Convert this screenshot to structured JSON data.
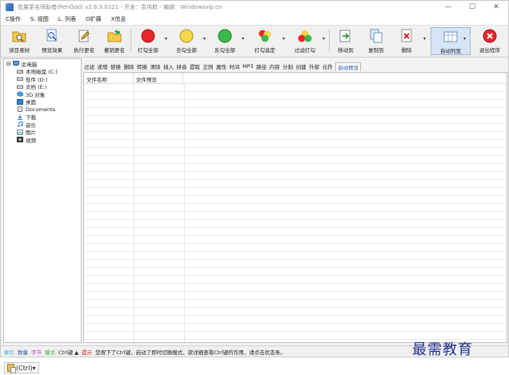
{
  "window": {
    "title": "批量更名师助者(RenGod) v2.6.3.0321 - 开发：袁伟航 - 编辑：Windowsvip.cn",
    "controls": [
      "—",
      "☐",
      "✕"
    ]
  },
  "menubar": {
    "items": [
      "C操作",
      "S. 视图",
      "L. 列表",
      "O扩展",
      "X信息"
    ]
  },
  "toolbar": {
    "buttons": [
      {
        "label": "读目录树",
        "icon": "folder-icon"
      },
      {
        "label": "预览效果",
        "icon": "magnifier-icon"
      },
      {
        "label": "执行更名",
        "icon": "pencil-icon"
      },
      {
        "label": "撤销更名",
        "icon": "undo-folder-icon"
      },
      {
        "label": "打勾全部",
        "icon": "red-circle-icon"
      },
      {
        "label": "去勾全部",
        "icon": "yellow-circle-icon"
      },
      {
        "label": "反勾全部",
        "icon": "green-circle-icon"
      },
      {
        "label": "打勾选定",
        "icon": "multi-color-circle-icon"
      },
      {
        "label": "过滤打勾",
        "icon": "filter-circle-icon"
      },
      {
        "label": "移动到",
        "icon": "move-to-icon"
      },
      {
        "label": "复制到",
        "icon": "copy-to-icon"
      },
      {
        "label": "删除",
        "icon": "delete-icon"
      },
      {
        "label": "自动列宽",
        "icon": "auto-width-icon"
      },
      {
        "label": "退出程序",
        "icon": "exit-icon"
      }
    ]
  },
  "tree": {
    "items": [
      {
        "label": "此电脑",
        "icon": "computer-icon",
        "level": 0,
        "expander": "⊟"
      },
      {
        "label": "本地磁盘 (C:)",
        "icon": "drive-icon",
        "level": 1
      },
      {
        "label": "软件 (D:)",
        "icon": "drive-icon",
        "level": 1
      },
      {
        "label": "文档 (E:)",
        "icon": "drive-icon",
        "level": 1
      },
      {
        "label": "3D 对象",
        "icon": "3d-objects-icon",
        "level": 1
      },
      {
        "label": "桌面",
        "icon": "desktop-icon",
        "level": 1
      },
      {
        "label": "Documents",
        "icon": "documents-icon",
        "level": 1
      },
      {
        "label": "下载",
        "icon": "download-icon",
        "level": 1
      },
      {
        "label": "音乐",
        "icon": "music-icon",
        "level": 1
      },
      {
        "label": "图片",
        "icon": "pictures-icon",
        "level": 1
      },
      {
        "label": "视频",
        "icon": "video-icon",
        "level": 1
      }
    ]
  },
  "filter_tabs": {
    "items": [
      "过滤",
      "递增",
      "替换",
      "删除",
      "转换",
      "清除",
      "插入",
      "拼音",
      "提取",
      "正则",
      "属性",
      "时间",
      "MP3",
      "路径",
      "内容",
      "分割",
      "创建",
      "外部",
      "元符",
      "自动预览"
    ],
    "active": "自动预览"
  },
  "grid": {
    "columns": [
      "文件名称",
      "文件预览"
    ]
  },
  "statusbar": {
    "items": [
      {
        "text": "索引",
        "color": "#3aa7d8"
      },
      {
        "text": "数量",
        "color": "#2e4fa0"
      },
      {
        "text": "字节",
        "color": "#c23ac0"
      },
      {
        "text": "模式",
        "color": "#4aa83a"
      },
      {
        "text": "Ctrl键 ▲",
        "color": "#222222"
      },
      {
        "text": "提示",
        "color": "#d02020"
      },
      {
        "text": "您按下了Ctrl键，启动了即时切换模式，欲详细查看Ctrl键的作用，请点击状态条。",
        "color": "#222222"
      }
    ]
  },
  "watermark": {
    "text": "最需教育"
  },
  "paste_popup": {
    "label": "(Ctrl)▾"
  }
}
